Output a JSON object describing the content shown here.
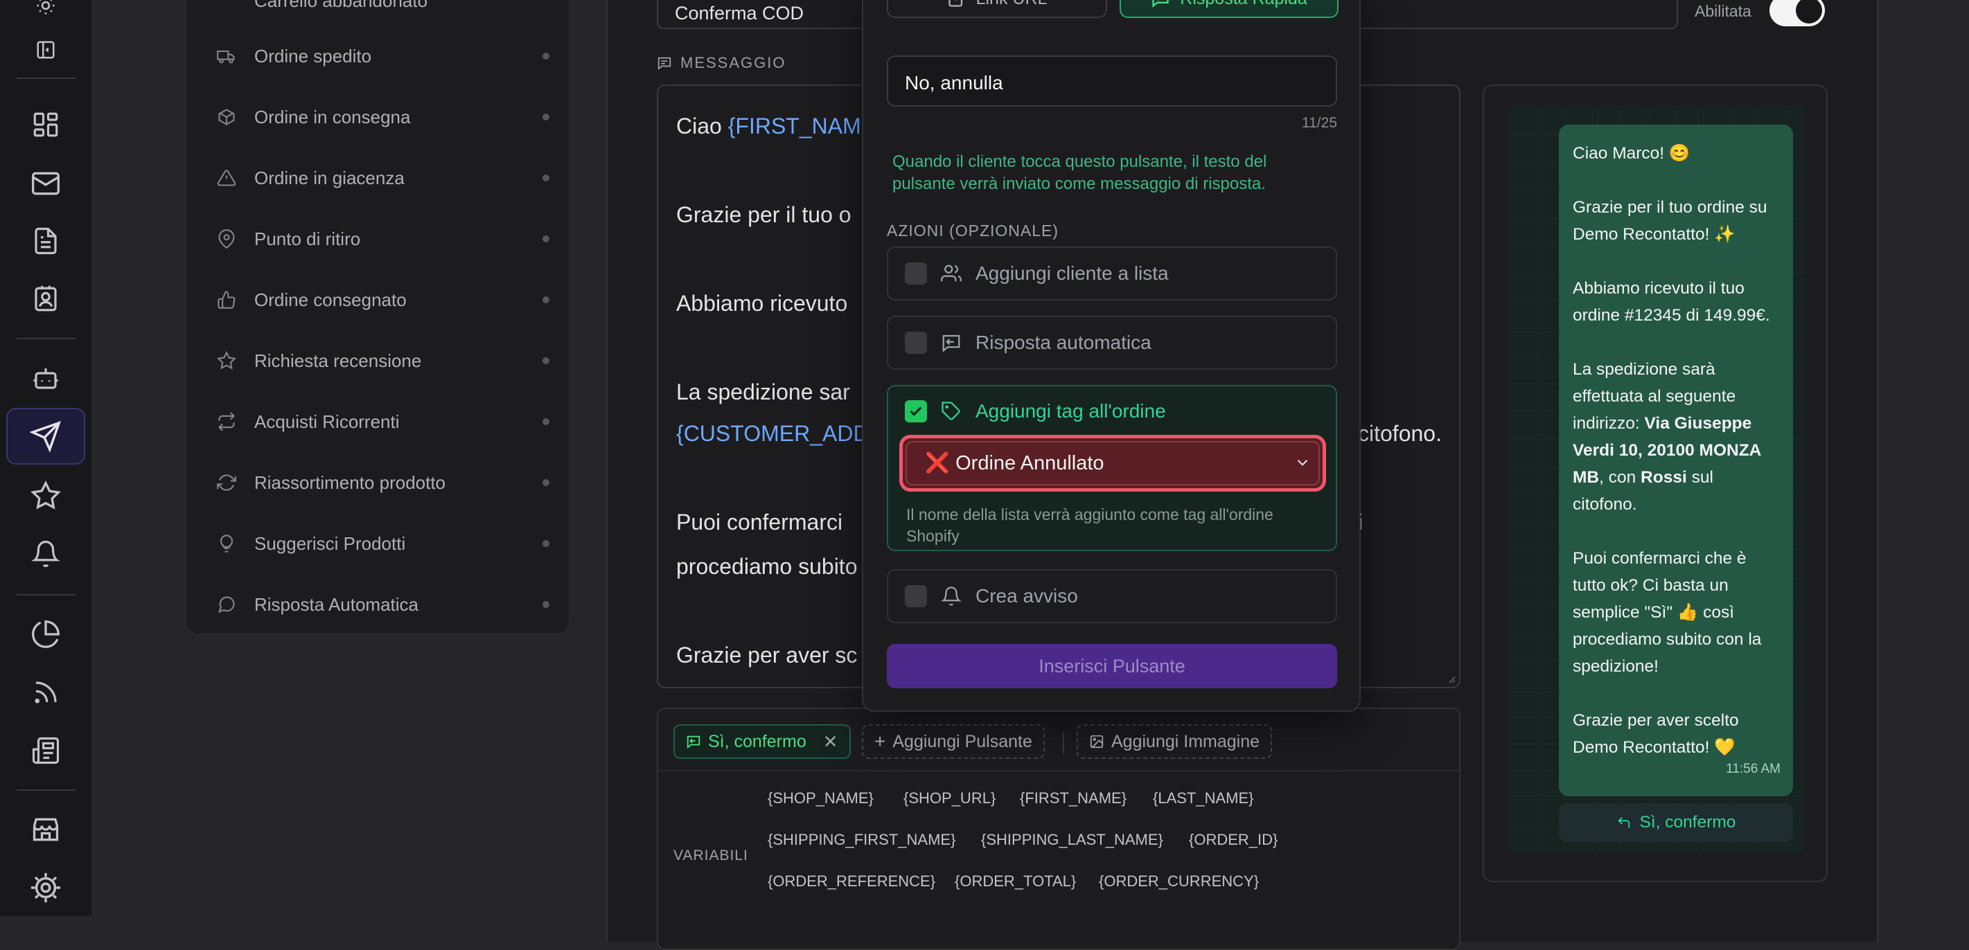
{
  "rail": {
    "icons": [
      "sun-icon",
      "sidebar-toggle-icon",
      "dashboard-icon",
      "mail-icon",
      "document-icon",
      "contacts-icon",
      "bot-icon",
      "send-icon",
      "star-icon",
      "bell-icon",
      "pie-chart-icon",
      "rss-icon",
      "news-icon",
      "store-icon",
      "settings-icon"
    ],
    "active": "send-icon"
  },
  "sidebar": {
    "top_partial": "Carrello abbandonato",
    "items": [
      {
        "label": "Ordine spedito",
        "icon": "truck-icon"
      },
      {
        "label": "Ordine in consegna",
        "icon": "package-icon"
      },
      {
        "label": "Ordine in giacenza",
        "icon": "warning-icon"
      },
      {
        "label": "Punto di ritiro",
        "icon": "map-pin-icon"
      },
      {
        "label": "Ordine consegnato",
        "icon": "thumbs-up-icon"
      },
      {
        "label": "Richiesta recensione",
        "icon": "star-icon"
      },
      {
        "label": "Acquisti Ricorrenti",
        "icon": "repeat-icon"
      },
      {
        "label": "Riassortimento prodotto",
        "icon": "refresh-icon"
      },
      {
        "label": "Suggerisci Prodotti",
        "icon": "lightbulb-icon"
      },
      {
        "label": "Risposta Automatica",
        "icon": "chat-bubble-icon"
      }
    ]
  },
  "template": {
    "name_value": "Conferma COD",
    "enabled_label": "Abilitata",
    "enabled": true,
    "message_label": "MESSAGGIO",
    "message_lines": {
      "l1a": "Ciao ",
      "l1b": "{FIRST_NAM",
      "l2": "Grazie per il tuo o",
      "l3": "Abbiamo ricevuto",
      "l4": "La spedizione sar",
      "l5a": "{CUSTOMER_ADD",
      "l5b": "citofono.",
      "l6a": "Puoi confermarci",
      "l6b": "i",
      "l7": "procediamo subito",
      "l8": "Grazie per aver sc"
    },
    "buttons": {
      "existing": "Sì, confermo",
      "add_button": "Aggiungi Pulsante",
      "add_image": "Aggiungi Immagine"
    },
    "variables_label": "VARIABILI",
    "variables": {
      "r1": [
        "{SHOP_NAME}",
        "{SHOP_URL}",
        "{FIRST_NAME}",
        "{LAST_NAME}"
      ],
      "r2": [
        "{SHIPPING_FIRST_NAME}",
        "{SHIPPING_LAST_NAME}",
        "{ORDER_ID}"
      ],
      "r3": [
        "{ORDER_REFERENCE}",
        "{ORDER_TOTAL}",
        "{ORDER_CURRENCY}"
      ]
    }
  },
  "modal": {
    "tab_link": "Link URL",
    "tab_quick": "Risposta Rapida",
    "active_tab": "Risposta Rapida",
    "button_text_value": "No, annulla",
    "char_count": "11/25",
    "hint": "Quando il cliente tocca questo pulsante, il testo del pulsante verrà inviato come messaggio di risposta.",
    "actions_label": "AZIONI (OPZIONALE)",
    "actions": {
      "add_to_list": {
        "label": "Aggiungi cliente a lista",
        "checked": false
      },
      "auto_reply": {
        "label": "Risposta automatica",
        "checked": false
      },
      "add_tag": {
        "label": "Aggiungi tag all'ordine",
        "checked": true
      },
      "alert": {
        "label": "Crea avviso",
        "checked": false
      }
    },
    "tag_select_emoji": "❌",
    "tag_select_value": "Ordine Annullato",
    "tag_note": "Il nome della lista verrà aggiunto come tag all'ordine Shopify",
    "insert_label": "Inserisci Pulsante"
  },
  "preview": {
    "p1": "Ciao Marco! 😊",
    "p2": "Grazie per il tuo ordine su Demo Recontatto! ✨",
    "p3": "Abbiamo ricevuto il tuo ordine #12345 di 149.99€.",
    "p4a": "La spedizione sarà effettuata al seguente indirizzo: ",
    "p4b": "Via Giuseppe Verdi 10, 20100 MONZA MB",
    "p4c": ", con ",
    "p4d": "Rossi",
    "p4e": " sul citofono.",
    "p5": "Puoi confermarci che è tutto ok? Ci basta un semplice \"Sì\" 👍 così procediamo subito con la spedizione!",
    "p6": "Grazie per aver scelto Demo Recontatto! 💛",
    "time": "11:56 AM",
    "quick_reply": "Sì, confermo"
  },
  "colors": {
    "accent_green": "#34d399",
    "accent_purple": "#4c2a8c",
    "highlight_red": "#f0566a",
    "bubble_green": "#245845"
  }
}
